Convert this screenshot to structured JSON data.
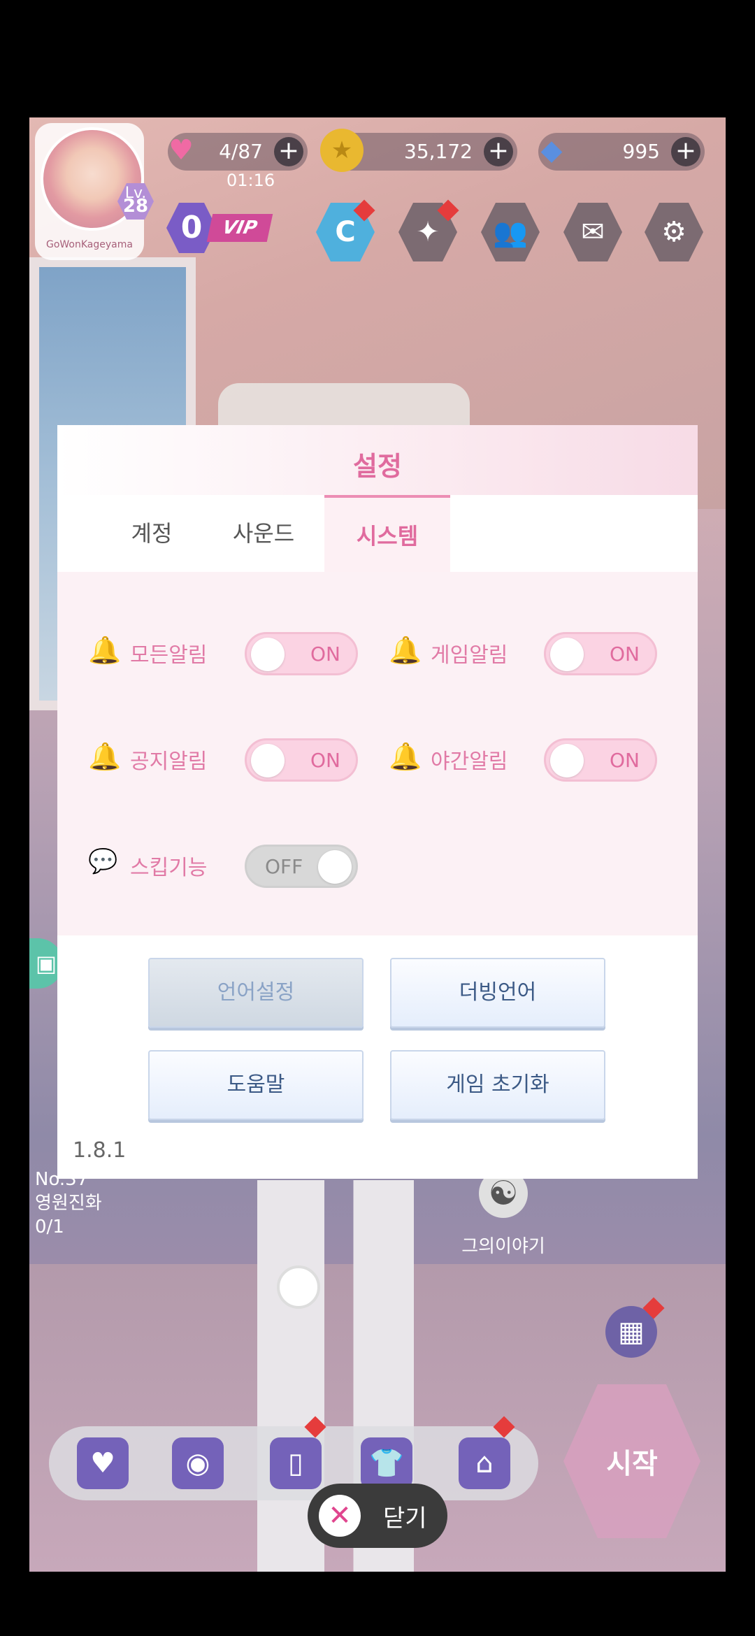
{
  "hud": {
    "username": "GoWonKageyama",
    "level_prefix": "Lv.",
    "level": "28",
    "hearts": "4/87",
    "heart_timer": "01:16",
    "coins": "35,172",
    "diamonds": "995",
    "vip_level": "0",
    "vip_label": "VIP",
    "c_button": "C"
  },
  "background": {
    "quest_no": "No.37",
    "quest_title": "영원진화",
    "quest_progress": "0/1",
    "story_label": "그의이야기",
    "start_label": "시작"
  },
  "dialog": {
    "title": "설정",
    "tabs": [
      "계정",
      "사운드",
      "시스템"
    ],
    "active_tab": "시스템",
    "options": [
      {
        "label": "모든알림",
        "state": "ON"
      },
      {
        "label": "게임알림",
        "state": "ON"
      },
      {
        "label": "공지알림",
        "state": "ON"
      },
      {
        "label": "야간알림",
        "state": "ON"
      },
      {
        "label": "스킵기능",
        "state": "OFF"
      }
    ],
    "buttons": {
      "language": "언어설정",
      "dubbing": "더빙언어",
      "help": "도움말",
      "reset": "게임 초기화"
    },
    "version": "1.8.1"
  },
  "close": {
    "label": "닫기"
  },
  "colors": {
    "accent": "#e06b9e",
    "toggle_on": "#fbd3e3",
    "toggle_off": "#d8d8d8"
  }
}
